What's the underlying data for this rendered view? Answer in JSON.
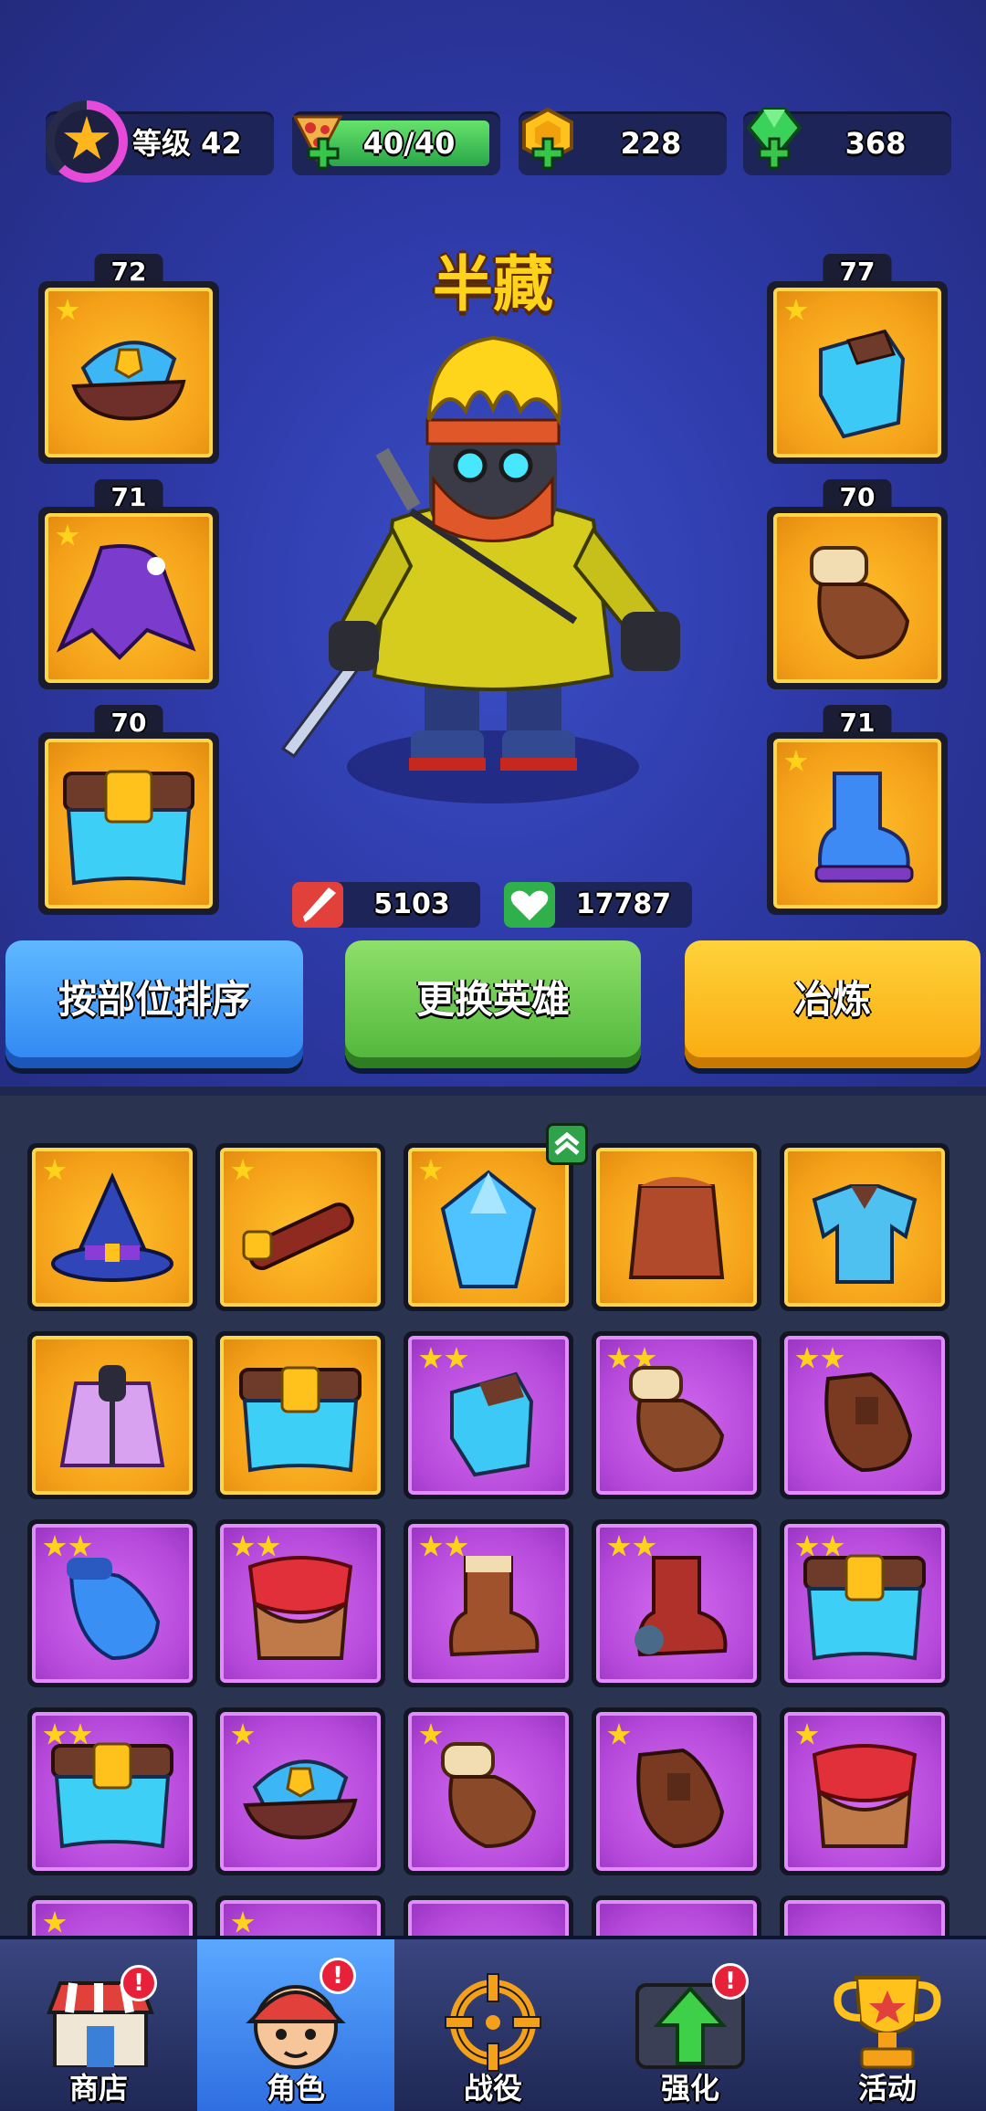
{
  "stats": {
    "level_label": "等级 42",
    "energy": "40/40",
    "gold": "228",
    "gems": "368"
  },
  "hero": {
    "name": "半藏",
    "attack": "5103",
    "hp": "17787"
  },
  "equipment": {
    "left": [
      {
        "level": "72",
        "item": "police-cap"
      },
      {
        "level": "71",
        "item": "purple-hood"
      },
      {
        "level": "70",
        "item": "blue-shorts"
      }
    ],
    "right": [
      {
        "level": "77",
        "item": "blue-vest"
      },
      {
        "level": "70",
        "item": "brown-glove"
      },
      {
        "level": "71",
        "item": "blue-boot"
      }
    ]
  },
  "buttons": {
    "sort": "按部位排序",
    "change_hero": "更换英雄",
    "smelt": "冶炼"
  },
  "inventory_rows": [
    [
      {
        "rarity": "gold",
        "stars": 1,
        "item": "wizard-hat"
      },
      {
        "rarity": "gold",
        "stars": 1,
        "item": "telescope"
      },
      {
        "rarity": "gold",
        "stars": 1,
        "item": "blue-gem",
        "upgrade": true
      },
      {
        "rarity": "gold",
        "stars": 0,
        "item": "brown-vest"
      },
      {
        "rarity": "gold",
        "stars": 0,
        "item": "blue-shirt"
      }
    ],
    [
      {
        "rarity": "gold",
        "stars": 0,
        "item": "pink-hoodie"
      },
      {
        "rarity": "gold",
        "stars": 0,
        "item": "blue-shorts"
      },
      {
        "rarity": "purple",
        "stars": 2,
        "item": "blue-vest"
      },
      {
        "rarity": "purple",
        "stars": 2,
        "item": "brown-glove"
      },
      {
        "rarity": "purple",
        "stars": 2,
        "item": "brown-glove-dark"
      }
    ],
    [
      {
        "rarity": "purple",
        "stars": 2,
        "item": "blue-glove"
      },
      {
        "rarity": "purple",
        "stars": 2,
        "item": "red-scarf"
      },
      {
        "rarity": "purple",
        "stars": 2,
        "item": "brown-boot"
      },
      {
        "rarity": "purple",
        "stars": 2,
        "item": "red-boot"
      },
      {
        "rarity": "purple",
        "stars": 2,
        "item": "blue-shorts"
      }
    ],
    [
      {
        "rarity": "purple",
        "stars": 2,
        "item": "blue-shorts"
      },
      {
        "rarity": "purple",
        "stars": 1,
        "item": "police-cap"
      },
      {
        "rarity": "purple",
        "stars": 1,
        "item": "brown-glove"
      },
      {
        "rarity": "purple",
        "stars": 1,
        "item": "brown-glove-dark"
      },
      {
        "rarity": "purple",
        "stars": 1,
        "item": "red-scarf"
      }
    ],
    [
      {
        "rarity": "purple",
        "stars": 1,
        "item": "partial"
      },
      {
        "rarity": "purple",
        "stars": 1,
        "item": "partial"
      },
      {
        "rarity": "purple",
        "stars": 0,
        "item": "partial"
      },
      {
        "rarity": "purple",
        "stars": 0,
        "item": "partial"
      },
      {
        "rarity": "purple",
        "stars": 0,
        "item": "partial"
      }
    ]
  ],
  "nav": [
    {
      "label": "商店",
      "icon": "shop-icon",
      "alert": "!"
    },
    {
      "label": "角色",
      "icon": "character-icon",
      "alert": "!"
    },
    {
      "label": "战役",
      "icon": "crosshair-icon"
    },
    {
      "label": "强化",
      "icon": "upgrade-arrow-icon",
      "alert": "!"
    },
    {
      "label": "活动",
      "icon": "trophy-icon"
    }
  ],
  "colors": {
    "gold_rarity": "#f4a019",
    "purple_rarity": "#b548da",
    "accent_yellow": "#ffd21c"
  }
}
